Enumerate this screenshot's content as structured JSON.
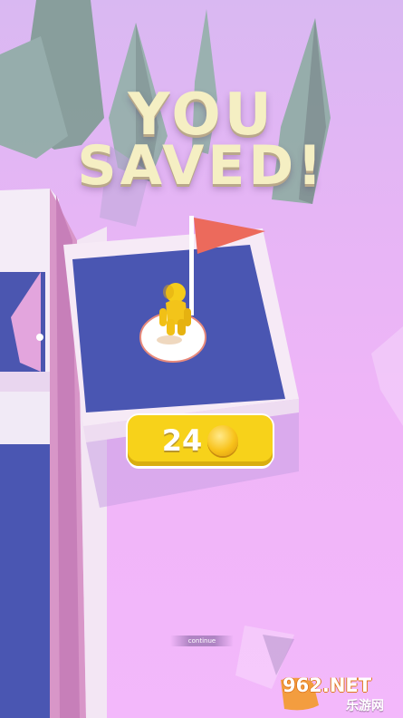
{
  "headline": {
    "line1": "YOU",
    "line2": "SAVED!"
  },
  "reward": {
    "amount": "24",
    "icon": "coin-icon"
  },
  "continue_label": "continue",
  "watermark": {
    "domain": "962.NET",
    "site": "乐游网"
  },
  "colors": {
    "title": "#f5efc3",
    "coin_badge": "#f7d21a",
    "flag": "#ec6a5c",
    "platform": "#4a56b2",
    "player": "#f5cc1a"
  }
}
